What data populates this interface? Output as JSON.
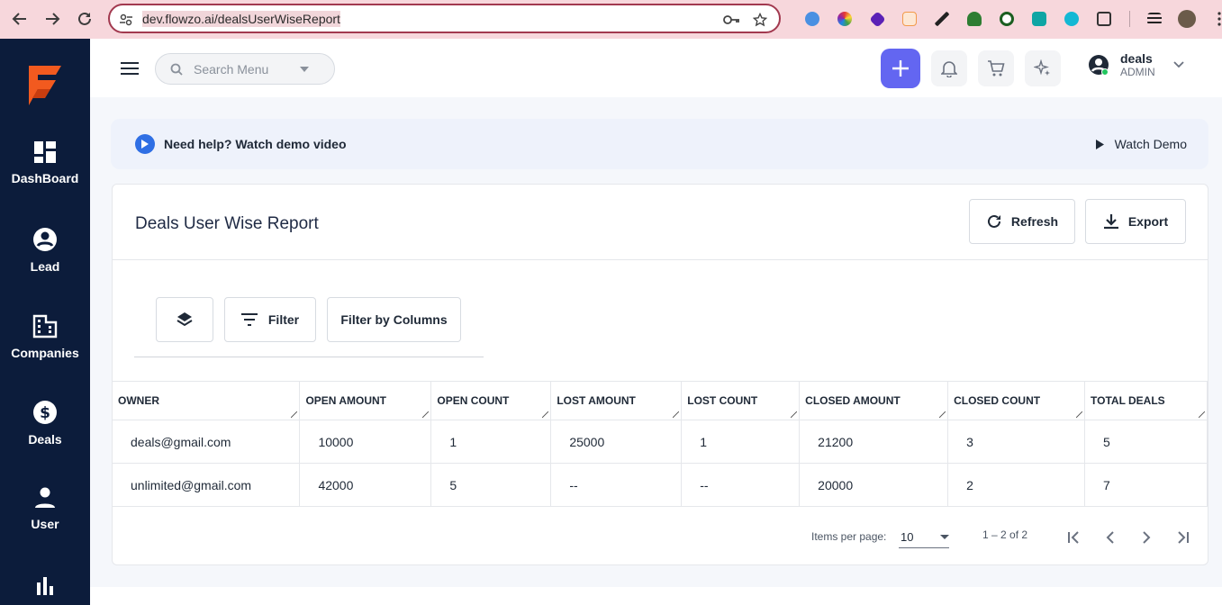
{
  "browser": {
    "url": "dev.flowzo.ai/dealsUserWiseReport"
  },
  "sidebar": {
    "items": [
      {
        "label": "DashBoard",
        "icon": "dashboard-icon"
      },
      {
        "label": "Lead",
        "icon": "account-circle-icon"
      },
      {
        "label": "Companies",
        "icon": "building-icon"
      },
      {
        "label": "Deals",
        "icon": "dollar-icon"
      },
      {
        "label": "User",
        "icon": "person-icon"
      }
    ]
  },
  "header": {
    "search_placeholder": "Search Menu",
    "user_name": "deals",
    "user_role": "ADMIN"
  },
  "help": {
    "text": "Need help? Watch demo video",
    "demo_label": "Watch Demo"
  },
  "report": {
    "title": "Deals User Wise Report",
    "refresh_label": "Refresh",
    "export_label": "Export",
    "filter_label": "Filter",
    "filter_columns_label": "Filter by Columns"
  },
  "table": {
    "columns": [
      "OWNER",
      "OPEN AMOUNT",
      "OPEN COUNT",
      "LOST AMOUNT",
      "LOST COUNT",
      "CLOSED AMOUNT",
      "CLOSED COUNT",
      "TOTAL DEALS"
    ],
    "rows": [
      [
        "deals@gmail.com",
        "10000",
        "1",
        "25000",
        "1",
        "21200",
        "3",
        "5"
      ],
      [
        "unlimited@gmail.com",
        "42000",
        "5",
        "--",
        "--",
        "20000",
        "2",
        "7"
      ]
    ]
  },
  "pagination": {
    "items_per_page_label": "Items per page:",
    "items_per_page": "10",
    "range": "1 – 2 of 2"
  },
  "colors": {
    "sidebar_bg": "#0c1c3b",
    "accent": "#6366f1",
    "logo": "#f25a1f"
  }
}
